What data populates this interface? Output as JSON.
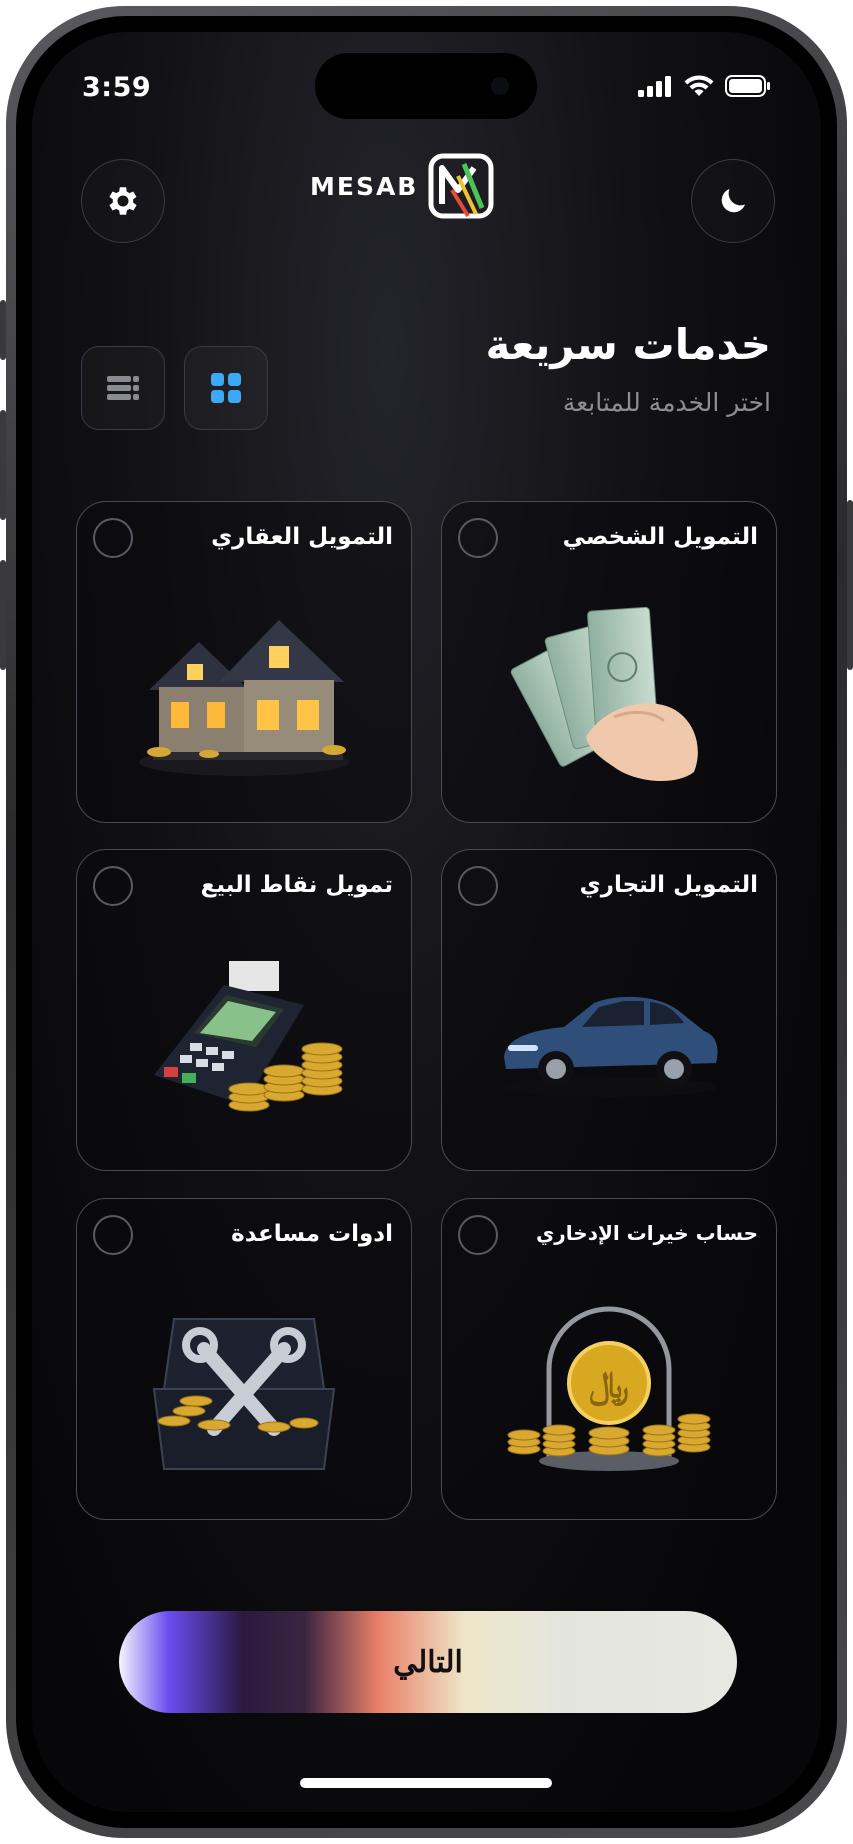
{
  "status": {
    "time": "3:59"
  },
  "header": {
    "logo_text": "MESAB",
    "settings_icon": "gear-icon",
    "theme_icon": "moon-icon"
  },
  "page": {
    "title": "خدمات سريعة",
    "subtitle": "اختر الخدمة للمتابعة"
  },
  "view_toggle": {
    "options": [
      "list",
      "grid"
    ],
    "selected": "grid",
    "active_color": "#3da8f5"
  },
  "services": [
    {
      "label": "التمويل الشخصي",
      "icon": "cash-in-hand-icon",
      "selected": false
    },
    {
      "label": "التمويل العقاري",
      "icon": "house-icon",
      "selected": false
    },
    {
      "label": "التمويل التجاري",
      "icon": "car-icon",
      "selected": false
    },
    {
      "label": "تمويل نقاط البيع",
      "icon": "pos-terminal-icon",
      "selected": false
    },
    {
      "label": "حساب خيرات الإدخاري",
      "icon": "savings-coin-icon",
      "selected": false
    },
    {
      "label": "ادوات مساعدة",
      "icon": "toolbox-icon",
      "selected": false
    }
  ],
  "footer": {
    "next_label": "التالي"
  }
}
